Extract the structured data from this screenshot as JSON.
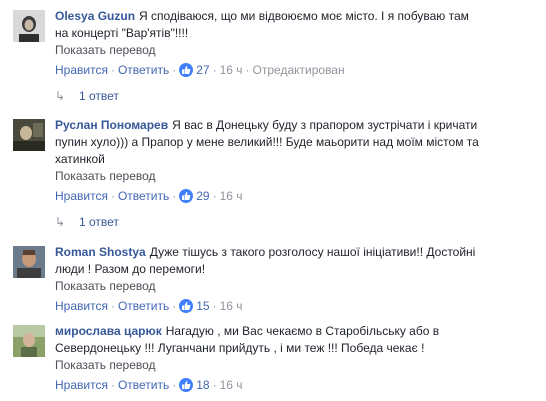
{
  "comments": [
    {
      "author": "Olesya Guzun",
      "text_lines": [
        "Я сподіваюся, що ми відвоюємо моє місто. І я побуваю там",
        "на концерті \"Вар'ятів\"!!!!"
      ],
      "translate": "Показать перевод",
      "like_label": "Нравится",
      "reply_label": "Ответить",
      "likes": "27",
      "time": "16 ч",
      "edited": "Отредактирован",
      "replies": "1 ответ"
    },
    {
      "author": "Руслан Пономарев",
      "text_lines": [
        "Я вас в Донецьку буду з прапором зустрічати і кричати",
        "пупин хуло))) а Прапор у мене великий!!! Буде маьорити над моїм містом та",
        "хатинкой"
      ],
      "translate": "Показать перевод",
      "like_label": "Нравится",
      "reply_label": "Ответить",
      "likes": "29",
      "time": "16 ч",
      "replies": "1 ответ"
    },
    {
      "author": "Roman Shostya",
      "text_lines": [
        "Дуже тішусь з такого розголосу нашої ініціативи!! Достойні",
        "люди ! Разом до перемоги!"
      ],
      "translate": "Показать перевод",
      "like_label": "Нравится",
      "reply_label": "Ответить",
      "likes": "15",
      "time": "16 ч"
    },
    {
      "author": "мирослава царюк",
      "text_lines": [
        "Нагадую , ми Вас чекаємо в Старобільську або в",
        "Севердонецьку !!! Луганчани прийдуть , і ми теж !!! Победа чекає !"
      ],
      "translate": "Показать перевод",
      "like_label": "Нравится",
      "reply_label": "Ответить",
      "likes": "18",
      "time": "16 ч"
    }
  ],
  "colors": {
    "author": "#365899",
    "link": "#4267b2",
    "meta": "#90949c",
    "like_badge": "#4080ff"
  }
}
